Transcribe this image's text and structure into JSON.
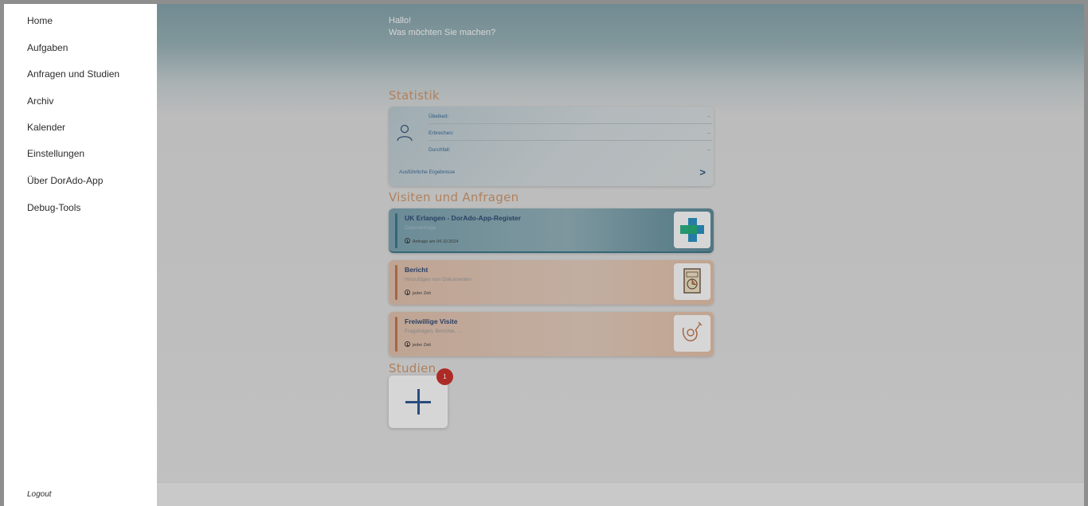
{
  "drawer": {
    "items": [
      {
        "label": "Home"
      },
      {
        "label": "Aufgaben"
      },
      {
        "label": "Anfragen und Studien"
      },
      {
        "label": "Archiv"
      },
      {
        "label": "Kalender"
      },
      {
        "label": "Einstellungen"
      },
      {
        "label": "Über DorAdo-App"
      },
      {
        "label": "Debug-Tools"
      }
    ],
    "logout": "Logout"
  },
  "greeting": {
    "line1": "Hallo!",
    "line2": "Was möchten Sie machen?"
  },
  "statistik": {
    "title": "Statistik",
    "rows": [
      {
        "label": "Übelkeit:",
        "value": "--"
      },
      {
        "label": "Erbrechen:",
        "value": "--"
      },
      {
        "label": "Durchfall:",
        "value": "--"
      }
    ],
    "link": "Ausführliche Ergebnisse",
    "chevron": ">"
  },
  "visiten": {
    "title": "Visiten und Anfragen",
    "cards": [
      {
        "title": "UK Erlangen - DorAdo-App-Register",
        "subtitle": "Datenanfrage",
        "time": "Anfrage am 04.10.2024",
        "icon": "medical-cross-icon"
      },
      {
        "title": "Bericht",
        "subtitle": "Hinzufügen von Dokumenten",
        "time": "jeder Zeit",
        "icon": "document-report-icon"
      },
      {
        "title": "Freiwillige Visite",
        "subtitle": "Fragebögen, Berichte, ...",
        "time": "jeder Zeit",
        "icon": "stethoscope-icon"
      }
    ]
  },
  "studien": {
    "title": "Studien",
    "badge": "1",
    "add_icon": "plus-icon"
  },
  "colors": {
    "accent_orange": "#c48a5e",
    "teal_card": "#2c6a7d",
    "badge_red": "#c0211c",
    "text_blue": "#1f3a66"
  }
}
